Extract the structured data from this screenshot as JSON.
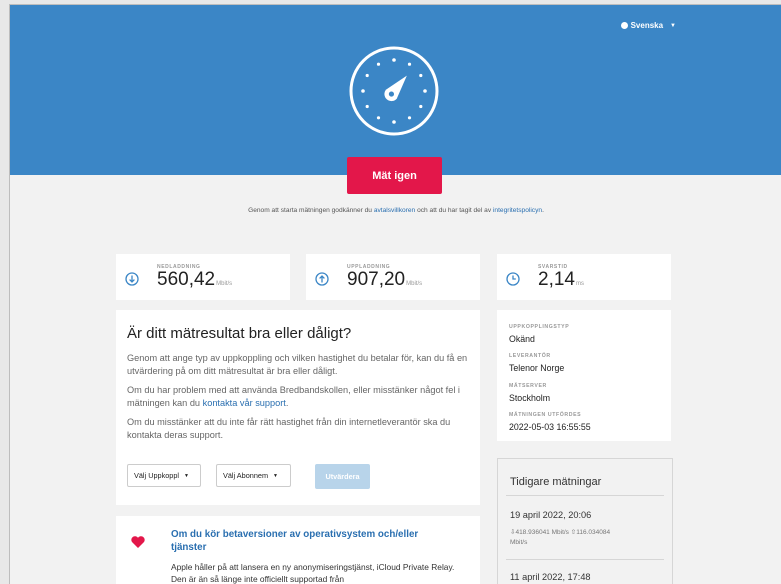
{
  "header": {
    "language": "Svenska",
    "measure_button": "Mät igen",
    "terms_before": "Genom att starta mätningen godkänner du ",
    "terms_link": "avtalsvillkoren",
    "terms_middle": " och att du har tagit del av ",
    "policy_link": "integritetspolicyn",
    "terms_end": "."
  },
  "stats": {
    "download": {
      "label": "NEDLADDNING",
      "value": "560,42",
      "unit": "Mbit/s"
    },
    "upload": {
      "label": "UPPLADDNING",
      "value": "907,20",
      "unit": "Mbit/s"
    },
    "latency": {
      "label": "SVARSTID",
      "value": "2,14",
      "unit": "ms"
    }
  },
  "evaluation": {
    "heading": "Är ditt mätresultat bra eller dåligt?",
    "p1": "Genom att ange typ av uppkoppling och vilken hastighet du betalar för, kan du få en utvärdering på om ditt mätresultat är bra eller dåligt.",
    "p2_before": "Om du har problem med att använda Bredbandskollen, eller misstänker något fel i mätningen kan du ",
    "p2_link": "kontakta vår support",
    "p2_end": ".",
    "p3": "Om du misstänker att du inte får rätt hastighet från din internetleverantör ska du kontakta deras support.",
    "select_connection": "Välj Uppkoppl",
    "select_subscription": "Välj Abonnem",
    "evaluate_button": "Utvärdera"
  },
  "info": {
    "connection_type_label": "UPPKOPPLINGSTYP",
    "connection_type": "Okänd",
    "provider_label": "LEVERANTÖR",
    "provider": "Telenor Norge",
    "server_label": "MÄTSERVER",
    "server": "Stockholm",
    "performed_label": "MÄTNINGEN UTFÖRDES",
    "performed": "2022-05-03 16:55:55"
  },
  "previous": {
    "title": "Tidigare mätningar",
    "items": [
      {
        "date": "19 april 2022, 20:06",
        "download": "418.936041 Mbit/s",
        "upload": "116.034084",
        "upload_unit": "Mbit/s"
      },
      {
        "date": "11 april 2022, 17:48"
      }
    ]
  },
  "notice": {
    "heading": "Om du kör betaversioner av operativsystem och/eller tjänster",
    "body": "Apple håller på att lansera en ny anonymiseringstjänst, iCloud Private Relay. Den är än så länge inte officiellt supportad från"
  },
  "colors": {
    "header_bg": "#3b86c6",
    "accent_red": "#e3174a",
    "link_blue": "#2a6fb0",
    "disabled_blue": "#b8d4ea"
  }
}
